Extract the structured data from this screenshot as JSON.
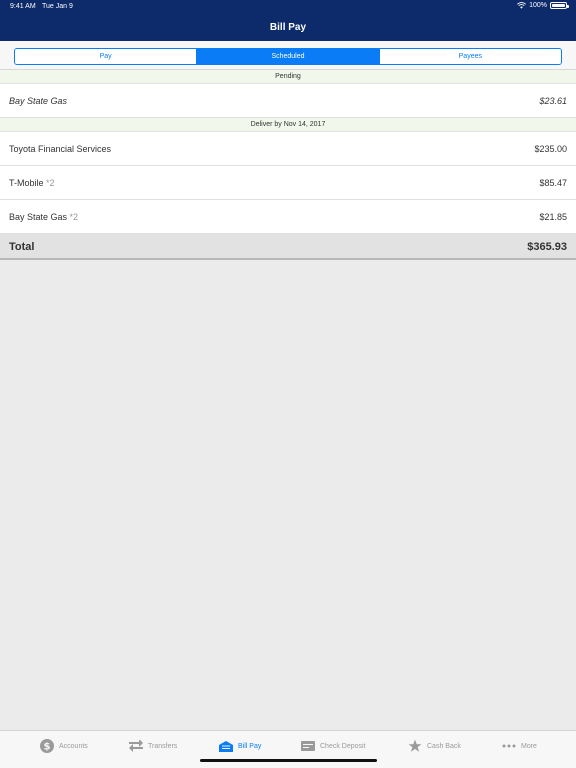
{
  "status_bar": {
    "time": "9:41 AM",
    "date": "Tue Jan 9",
    "battery": "100%"
  },
  "header": {
    "title": "Bill Pay"
  },
  "segments": [
    {
      "label": "Pay",
      "active": false
    },
    {
      "label": "Scheduled",
      "active": true
    },
    {
      "label": "Payees",
      "active": false
    }
  ],
  "pending_section": {
    "title": "Pending",
    "rows": [
      {
        "name": "Bay State Gas",
        "amount": "$23.61"
      }
    ]
  },
  "scheduled_section": {
    "title": "Deliver by Nov 14, 2017",
    "rows": [
      {
        "name": "Toyota Financial Services",
        "count": "",
        "amount": "$235.00"
      },
      {
        "name": "T-Mobile",
        "count": " *2",
        "amount": "$85.47"
      },
      {
        "name": "Bay State Gas",
        "count": " *2",
        "amount": "$21.85"
      }
    ]
  },
  "total": {
    "label": "Total",
    "amount": "$365.93"
  },
  "tabbar": [
    {
      "label": "Accounts",
      "icon": "dollar-circle-icon",
      "active": false
    },
    {
      "label": "Transfers",
      "icon": "arrows-icon",
      "active": false
    },
    {
      "label": "Bill Pay",
      "icon": "bill-icon",
      "active": true
    },
    {
      "label": "Check Deposit",
      "icon": "check-icon",
      "active": false
    },
    {
      "label": "Cash Back",
      "icon": "star-icon",
      "active": false
    },
    {
      "label": "More",
      "icon": "ellipsis-icon",
      "active": false
    }
  ],
  "colors": {
    "header": "#0d2a6b",
    "accent": "#0a7cf5",
    "section_header": "#f1f7ea"
  }
}
